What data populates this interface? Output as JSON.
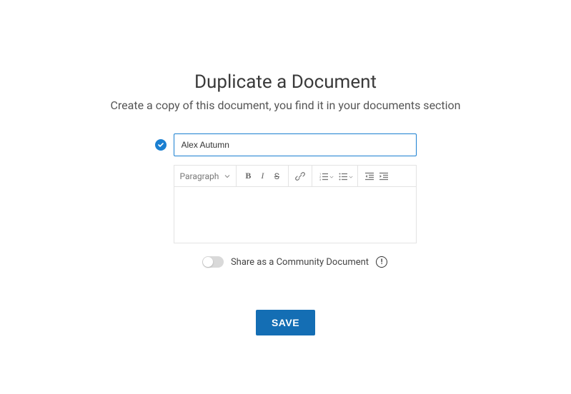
{
  "header": {
    "title": "Duplicate a Document",
    "subtitle": "Create a copy of this document, you find it in your documents section"
  },
  "form": {
    "title_value": "Alex Autumn",
    "title_placeholder": "",
    "editor": {
      "block_style_label": "Paragraph",
      "buttons": {
        "bold": "B",
        "italic": "I",
        "strike": "S"
      },
      "content": ""
    }
  },
  "share": {
    "label": "Share as a Community Document",
    "enabled": false,
    "info_glyph": "!"
  },
  "actions": {
    "save_label": "SAVE"
  }
}
